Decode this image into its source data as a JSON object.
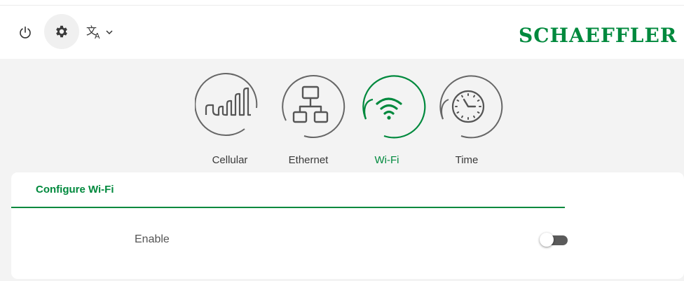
{
  "header": {
    "brand": "SCHAEFFLER",
    "icons": {
      "power": "power-icon",
      "settings": "gear-icon",
      "language": "translate-icon",
      "language_caret": "chevron-down-icon"
    },
    "brand_color": "#00893d"
  },
  "nav": {
    "items": [
      {
        "label": "Cellular",
        "icon": "cellular-signal-icon",
        "active": false
      },
      {
        "label": "Ethernet",
        "icon": "ethernet-network-icon",
        "active": false
      },
      {
        "label": "Wi-Fi",
        "icon": "wifi-icon",
        "active": true
      },
      {
        "label": "Time",
        "icon": "clock-icon",
        "active": false
      }
    ]
  },
  "card": {
    "title": "Configure Wi-Fi",
    "fields": [
      {
        "label": "Enable",
        "type": "toggle",
        "value": false
      }
    ]
  },
  "colors": {
    "accent": "#00893d",
    "inactive_icon": "#666666",
    "background": "#f3f3f3"
  }
}
